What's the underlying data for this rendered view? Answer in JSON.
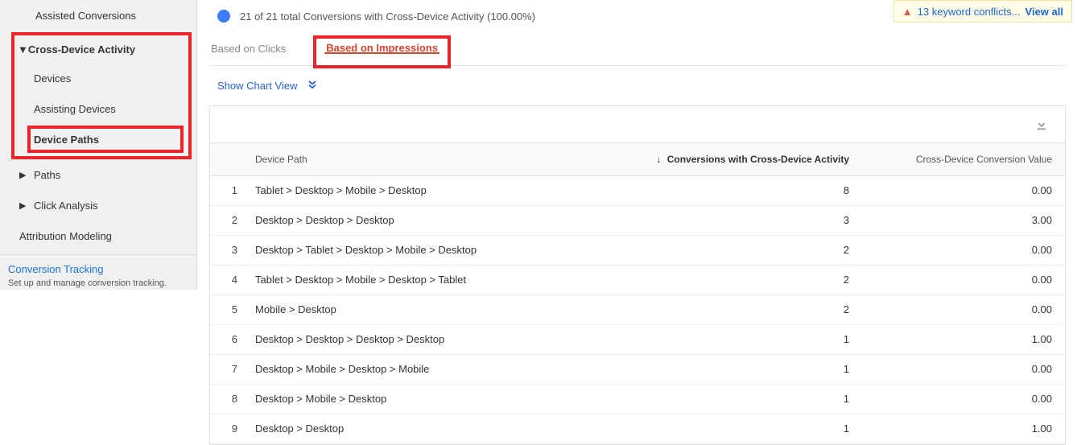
{
  "notice": {
    "warn_glyph": "▲",
    "text": "13 keyword conflicts...",
    "view_all": "View all"
  },
  "sidebar": {
    "assisted_conversions": "Assisted Conversions",
    "cross_device_section": "Cross-Device Activity",
    "devices": "Devices",
    "assisting_devices": "Assisting Devices",
    "device_paths": "Device Paths",
    "paths": "Paths",
    "click_analysis": "Click Analysis",
    "attribution_modeling": "Attribution Modeling",
    "conversion_tracking_link": "Conversion Tracking",
    "conversion_tracking_sub": "Set up and manage conversion tracking."
  },
  "summary": "21 of 21 total Conversions with Cross-Device Activity (100.00%)",
  "tabs": {
    "clicks": "Based on Clicks",
    "impressions": "Based on Impressions"
  },
  "chart_toggle": "Show Chart View",
  "columns": {
    "device_path": "Device Path",
    "conversions": "Conversions with Cross-Device Activity",
    "value": "Cross-Device Conversion Value"
  },
  "rows": [
    {
      "idx": 1,
      "path": "Tablet > Desktop > Mobile > Desktop",
      "conversions": "8",
      "value": "0.00"
    },
    {
      "idx": 2,
      "path": "Desktop > Desktop > Desktop",
      "conversions": "3",
      "value": "3.00"
    },
    {
      "idx": 3,
      "path": "Desktop > Tablet > Desktop > Mobile > Desktop",
      "conversions": "2",
      "value": "0.00"
    },
    {
      "idx": 4,
      "path": "Tablet > Desktop > Mobile > Desktop > Tablet",
      "conversions": "2",
      "value": "0.00"
    },
    {
      "idx": 5,
      "path": "Mobile > Desktop",
      "conversions": "2",
      "value": "0.00"
    },
    {
      "idx": 6,
      "path": "Desktop > Desktop > Desktop > Desktop",
      "conversions": "1",
      "value": "1.00"
    },
    {
      "idx": 7,
      "path": "Desktop > Mobile > Desktop > Mobile",
      "conversions": "1",
      "value": "0.00"
    },
    {
      "idx": 8,
      "path": "Desktop > Mobile > Desktop",
      "conversions": "1",
      "value": "0.00"
    },
    {
      "idx": 9,
      "path": "Desktop > Desktop",
      "conversions": "1",
      "value": "1.00"
    }
  ]
}
